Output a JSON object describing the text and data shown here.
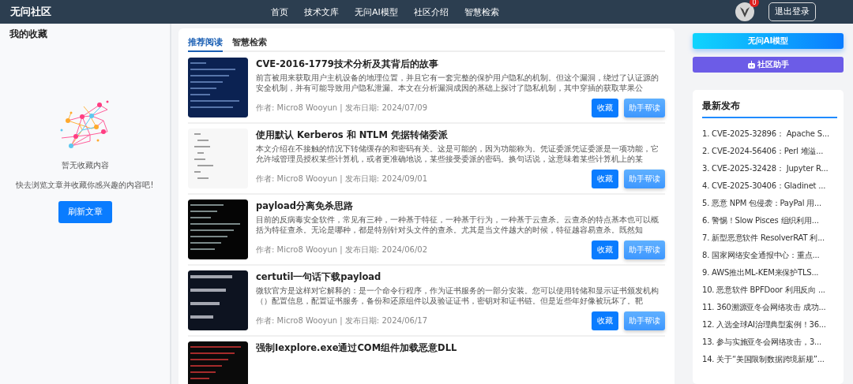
{
  "header": {
    "logo": "无问社区",
    "nav": [
      "首页",
      "技术文库",
      "无问AI模型",
      "社区介绍",
      "智慧检索"
    ],
    "notification_count": "0",
    "logout": "退出登录"
  },
  "favorites": {
    "title": "我的收藏",
    "empty_title": "暂无收藏内容",
    "empty_hint": "快去浏览文章并收藏你感兴趣的内容吧!",
    "refresh": "刷新文章"
  },
  "tabs": [
    {
      "label": "推荐阅读",
      "selected": true
    },
    {
      "label": "智慧检索",
      "selected": false
    }
  ],
  "articles": [
    {
      "title": "CVE-2016-1779技术分析及其背后的故事",
      "summary": "前言被用来获取用户主机设备的地理位置，并且它有一套完整的保护用户隐私的机制。但这个漏洞，绕过了认证源的安全机制，并有可能导致用户隐私泄漏。本文在分析漏洞成因的基础上探讨了隐私机制，其中穿插的获取苹果公",
      "meta": "作者: Micro8 Wooyun | 发布日期: 2024/07/09",
      "collect": "收藏",
      "assist": "助手帮读"
    },
    {
      "title": "使用默认 Kerberos 和 NTLM 凭据转储委派",
      "summary": "本文介绍在不接触的情况下转储缓存的和密码有关。这是可能的，因为功能称为。凭证委派凭证委派是一项功能，它允许域管理员授权某些计算机，或者更准确地说，某些接受委派的密码。换句话说，这意味着某些计算机上的某",
      "meta": "作者: Micro8 Wooyun | 发布日期: 2024/09/01",
      "collect": "收藏",
      "assist": "助手帮读"
    },
    {
      "title": "payload分离免杀思路",
      "summary": "目前的反病毒安全软件，常见有三种，一种基于特征，一种基于行为，一种基于云查杀。云查杀的特点基本也可以概括为特征查杀。无论是哪种，都是特别针对头文件的查杀。尤其是当文件越大的时候，特征越容易查杀。既然知",
      "meta": "作者: Micro8 Wooyun | 发布日期: 2024/06/02",
      "collect": "收藏",
      "assist": "助手帮读"
    },
    {
      "title": "certutil一句话下载payload",
      "summary": "微软官方是这样对它解释的：是一个命令行程序，作为证书服务的一部分安装。您可以使用转储和显示证书颁发机构（）配置信息，配置证书服务，备份和还原组件以及验证证书，密钥对和证书链。但是近些年好像被玩坏了。靶",
      "meta": "作者: Micro8 Wooyun | 发布日期: 2024/06/17",
      "collect": "收藏",
      "assist": "助手帮读"
    },
    {
      "title": "强制Iexplore.exe通过COM组件加载恶意DLL"
    }
  ],
  "side": {
    "ai_button": "无问AI模型",
    "assistant_button": "社区助手",
    "latest_title": "最新发布",
    "latest": [
      "1. CVE-2025-32896： Apache S...",
      "2. CVE-2024-56406：Perl 堆溢...",
      "3. CVE-2025-32428： Jupyter R...",
      "4. CVE-2025-30406：Gladinet ...",
      "5. 恶意 NPM 包侵袭：PayPal 用...",
      "6. 警惕！Slow Pisces 组织利用...",
      "7. 新型恶意软件 ResolverRAT 利...",
      "8. 国家网络安全通报中心：重点...",
      "9. AWS推出ML-KEM来保护TLS...",
      "10. 恶意软件 BPFDoor 利用反向 ...",
      "11. 360溯源亚冬会网络攻击 成功...",
      "12. 入选全球AI治理典型案例！36...",
      "13. 参与实施亚冬会网络攻击，3...",
      "14. 关于“美国限制数据跨境新规”..."
    ]
  }
}
